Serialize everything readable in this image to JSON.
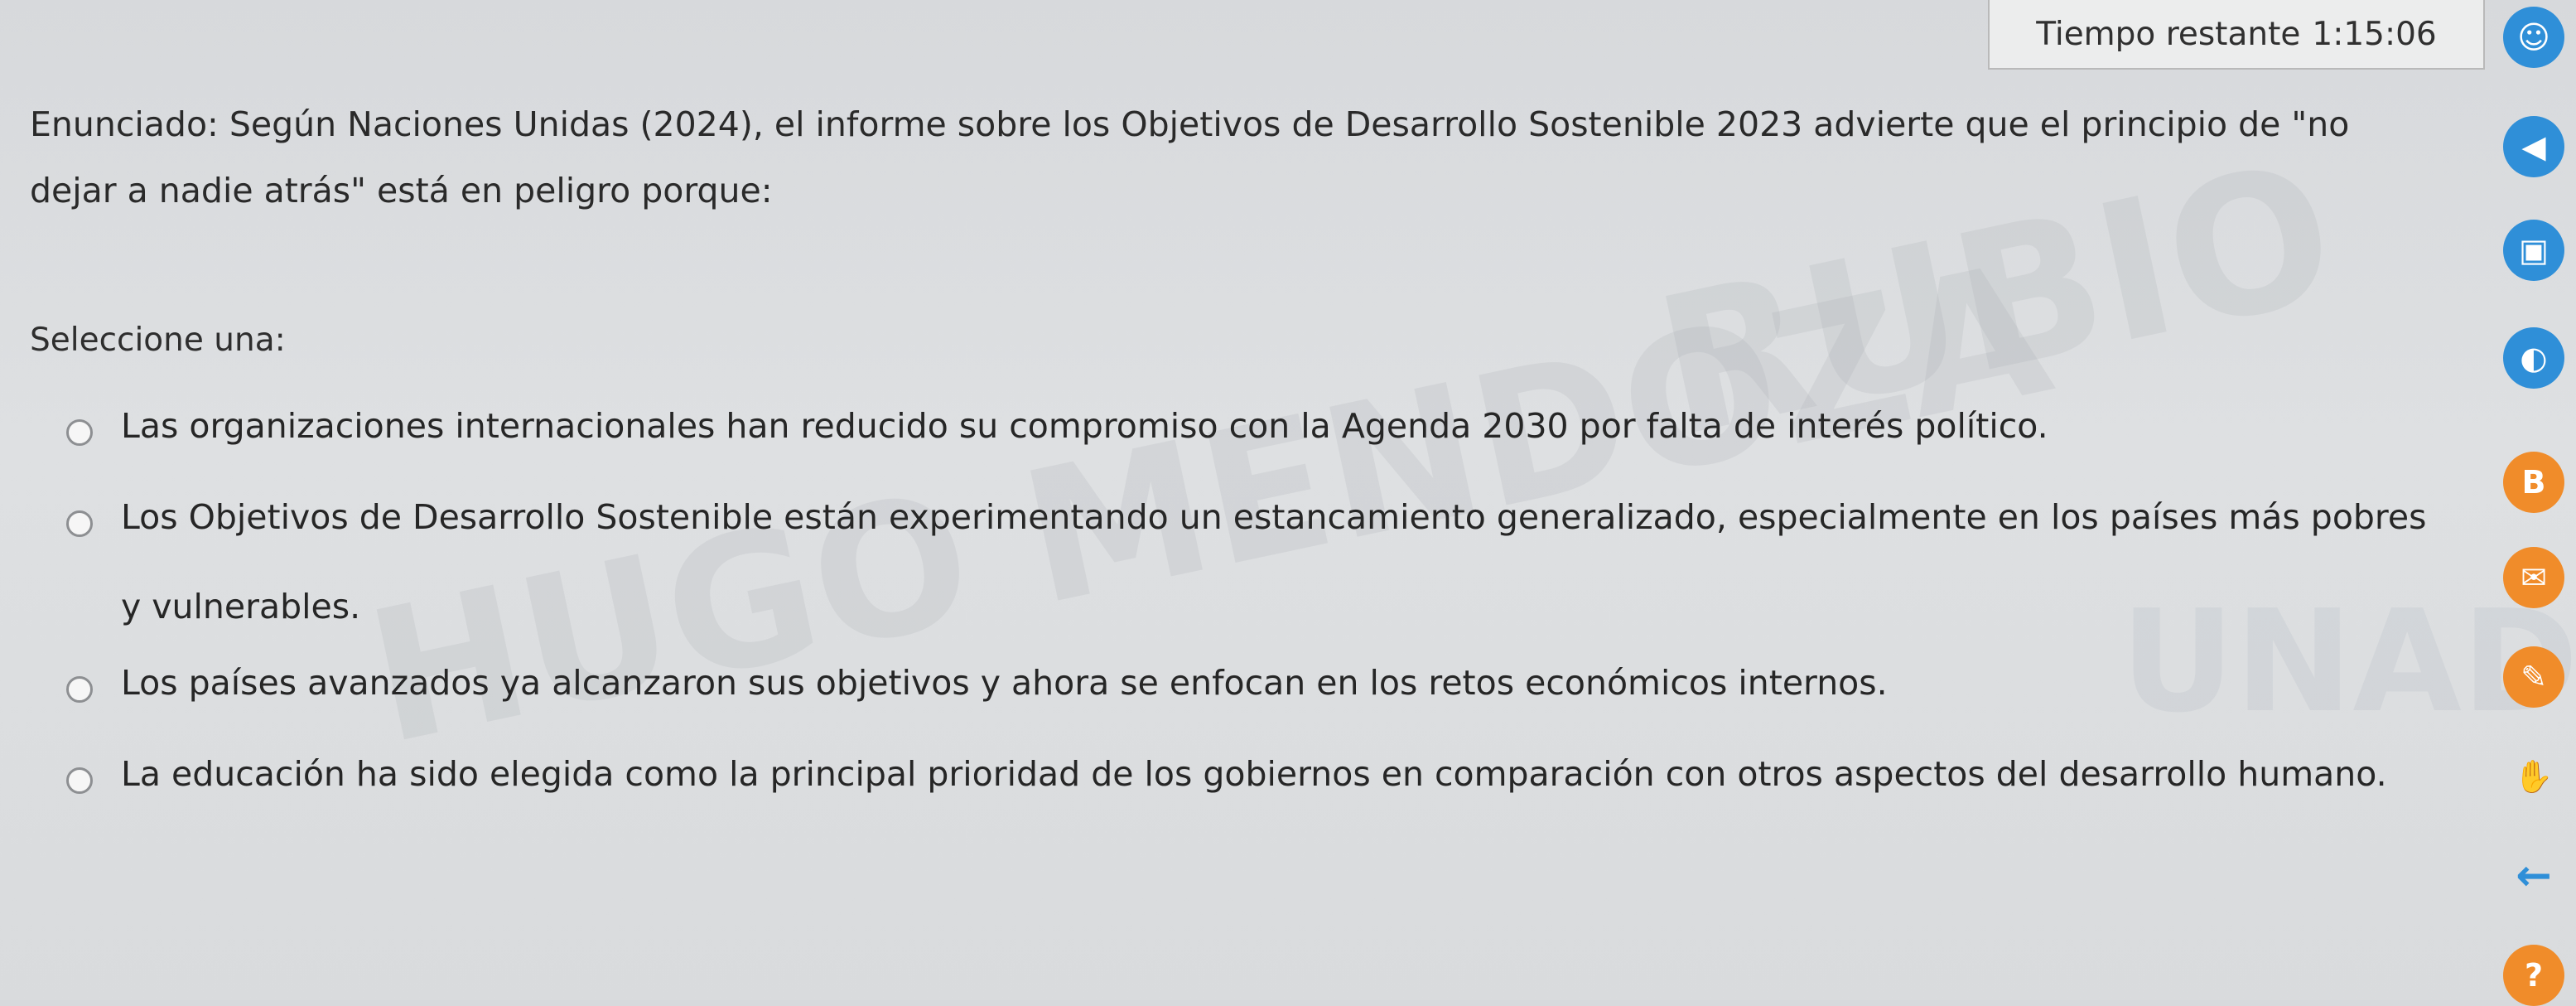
{
  "timer": {
    "label": "Tiempo restante",
    "value": "1:15:06"
  },
  "question": {
    "statement": "Enunciado: Según Naciones Unidas (2024), el informe sobre los Objetivos de Desarrollo Sostenible 2023 advierte que el principio de \"no dejar a nadie atrás\" está en peligro porque:"
  },
  "answer_prompt": "Seleccione una:",
  "options": [
    {
      "text": "Las organizaciones internacionales han reducido su compromiso con la Agenda 2030 por falta de interés político.",
      "selected": false
    },
    {
      "text": "Los Objetivos de Desarrollo Sostenible están experimentando un estancamiento generalizado, especialmente en los países más pobres y vulnerables.",
      "selected": false
    },
    {
      "text": "Los países avanzados ya alcanzaron sus objetivos y ahora se enfocan en los retos económicos internos.",
      "selected": false
    },
    {
      "text": "La educación ha sido elegida como la principal prioridad de los gobiernos en comparación con otros aspectos del desarrollo humano.",
      "selected": false
    }
  ],
  "watermark": {
    "line1": "RUBIO",
    "line2": "HUGO MENDOZA",
    "line3": "UNAD"
  },
  "sidebar_icons": [
    {
      "name": "accessibility-icon",
      "color": "#2f8fd8",
      "glyph": "☺"
    },
    {
      "name": "audio-icon",
      "color": "#2f8fd8",
      "glyph": "◀"
    },
    {
      "name": "image-icon",
      "color": "#2f8fd8",
      "glyph": "▣"
    },
    {
      "name": "contrast-icon",
      "color": "#2f8fd8",
      "glyph": "◐"
    },
    {
      "name": "text-icon",
      "color": "#f08c2a",
      "glyph": "B"
    },
    {
      "name": "mail-icon",
      "color": "#f08c2a",
      "glyph": "✉"
    },
    {
      "name": "chat-icon",
      "color": "#f08c2a",
      "glyph": "✎"
    },
    {
      "name": "sign-language-icon",
      "color": "#2f8fd8",
      "glyph": "✋"
    },
    {
      "name": "back-icon",
      "color": "#2f8fd8",
      "glyph": "←"
    },
    {
      "name": "help-icon",
      "color": "#f08c2a",
      "glyph": "?"
    }
  ],
  "colors": {
    "accent_blue": "#2f8fd8",
    "accent_orange": "#f08c2a"
  }
}
